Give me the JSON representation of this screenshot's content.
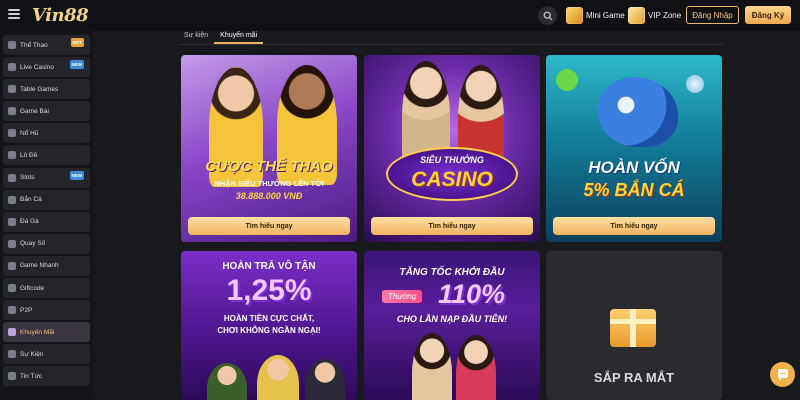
{
  "header": {
    "logo": "Vin88",
    "mini_game": "Mini Game",
    "vip_zone": "VIP Zone",
    "login": "Đăng Nhập",
    "register": "Đăng Ký"
  },
  "sidebar": {
    "items": [
      {
        "label": "Thể Thao",
        "badge": "HOT",
        "badge_color": "#e8a43b"
      },
      {
        "label": "Live Casino",
        "badge": "NEW",
        "badge_color": "#3a8ed8"
      },
      {
        "label": "Table Games"
      },
      {
        "label": "Game Bài"
      },
      {
        "label": "Nổ Hũ"
      },
      {
        "label": "Lô Đề"
      },
      {
        "label": "Slots",
        "badge": "NEW",
        "badge_color": "#3a8ed8"
      },
      {
        "label": "Bắn Cá"
      },
      {
        "label": "Đá Gà"
      },
      {
        "label": "Quay Số"
      },
      {
        "label": "Game Nhanh"
      },
      {
        "label": "Giftcode"
      },
      {
        "label": "P2P"
      },
      {
        "label": "Khuyến Mãi",
        "active": true
      },
      {
        "label": "Sự Kiện"
      },
      {
        "label": "Tin Tức"
      }
    ]
  },
  "tabs": [
    "Sự kiện",
    "Khuyến mãi"
  ],
  "cards": [
    {
      "title_line1": "CƯỢC THỂ THAO",
      "subtitle": "NHẬN SIÊU THƯỞNG LÊN TỚI",
      "amount": "38.888.000 VNĐ",
      "button": "Tìm hiểu ngay"
    },
    {
      "title_line1": "SIÊU THƯỞNG",
      "title_line2": "CASINO",
      "button": "Tìm hiểu ngay"
    },
    {
      "title_line1": "HOÀN VỐN",
      "title_line2": "5% BẮN CÁ",
      "button": "Tìm hiểu ngay"
    },
    {
      "title_line1": "HOÀN TRẢ VÔ TẬN",
      "title_line2": "1,25%",
      "subtitle": "HOÀN TIỀN CỰC CHẤT,",
      "subtitle2": "CHƠI KHÔNG NGẦN NGẠI!"
    },
    {
      "title_line1": "TĂNG TỐC KHỞI ĐẦU",
      "tag": "Thưởng",
      "title_line2": "110%",
      "subtitle": "CHO LẦN NẠP ĐẦU TIÊN!"
    },
    {
      "title_line1": "SẮP RA MẮT"
    }
  ]
}
